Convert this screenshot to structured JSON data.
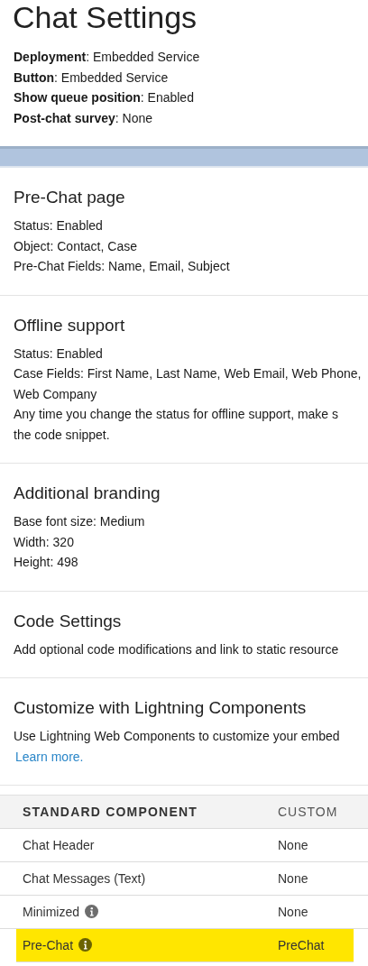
{
  "title": "Chat Settings",
  "summary": [
    "**Deployment**: Embedded Service",
    "**Button**: Embedded Service",
    "**Show queue position**: Enabled",
    "**Post-chat survey**: None"
  ],
  "sections": [
    {
      "title": "Pre-Chat page",
      "lines": [
        "Status: Enabled",
        "Object: Contact, Case",
        "Pre-Chat Fields: Name, Email, Subject"
      ]
    },
    {
      "title": "Offline support",
      "lines": [
        "Status: Enabled",
        "Case Fields: First Name, Last Name, Web Email, Web Phone,",
        "Web Company",
        "Any time you change the status for offline support, make s",
        "the code snippet."
      ]
    },
    {
      "title": "Additional branding",
      "lines": [
        "Base font size: Medium",
        "Width: 320",
        "Height: 498"
      ]
    },
    {
      "title": "Code Settings",
      "lines": [
        "Add optional code modifications and link to static resource"
      ]
    },
    {
      "title": "Customize with Lightning Components",
      "lines": [
        "Use Lightning Web Components to customize your embed"
      ],
      "link": "Learn more."
    }
  ],
  "table": {
    "columns": [
      "STANDARD COMPONENT",
      "CUSTOM"
    ],
    "rows": [
      {
        "component": "Chat Header",
        "info": false,
        "custom": "None",
        "highlighted": false
      },
      {
        "component": "Chat Messages (Text)",
        "info": false,
        "custom": "None",
        "highlighted": false
      },
      {
        "component": "Minimized",
        "info": true,
        "custom": "None",
        "highlighted": false
      },
      {
        "component": "Pre-Chat",
        "info": true,
        "custom": "PreChat",
        "highlighted": true
      }
    ]
  }
}
